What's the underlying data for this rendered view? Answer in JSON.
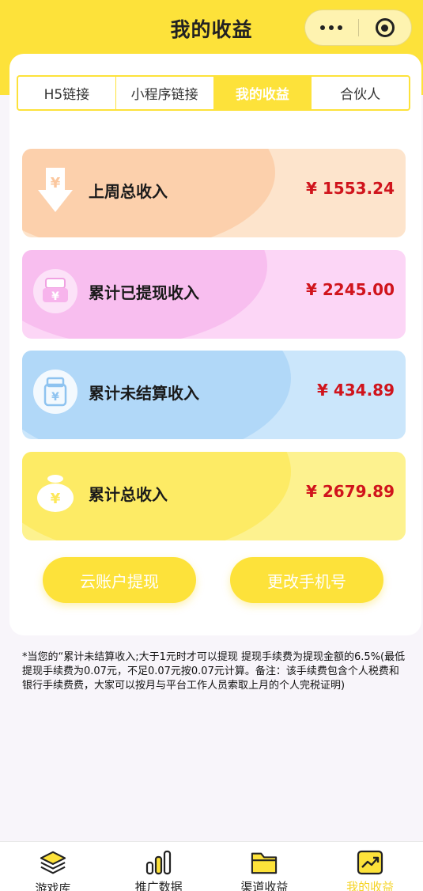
{
  "header": {
    "title": "我的收益"
  },
  "tabs": [
    {
      "label": "H5链接",
      "active": false
    },
    {
      "label": "小程序链接",
      "active": false
    },
    {
      "label": "我的收益",
      "active": true
    },
    {
      "label": "合伙人",
      "active": false
    }
  ],
  "cards": [
    {
      "label": "上周总收入",
      "amount": "¥ 1553.24",
      "icon": "download-yen-icon",
      "icon_glyph": "¥",
      "color": "#fde0c8"
    },
    {
      "label": "累计已提现收入",
      "amount": "¥ 2245.00",
      "icon": "cash-register-icon",
      "icon_glyph": "¥",
      "color": "#fbd0f4"
    },
    {
      "label": "累计未结算收入",
      "amount": "¥ 434.89",
      "icon": "wallet-icon",
      "icon_glyph": "¥",
      "color": "#c5e2fa"
    },
    {
      "label": "累计总收入",
      "amount": "¥ 2679.89",
      "icon": "money-bag-icon",
      "icon_glyph": "¥",
      "color": "#fdf08c"
    }
  ],
  "buttons": {
    "withdraw": "云账户提现",
    "change_phone": "更改手机号"
  },
  "note": "*当您的“累计未结算收入;大于1元时才可以提现 提现手续费为提现金额的6.5%(最低提现手续费为0.07元，不足0.07元按0.07元计算。备注：该手续费包含个人税费和银行手续费费，大家可以按月与平台工作人员索取上月的个人完税证明)",
  "tabbar": [
    {
      "label": "游戏库",
      "icon": "stack-icon",
      "active": false
    },
    {
      "label": "推广数据",
      "icon": "bar-chart-icon",
      "active": false
    },
    {
      "label": "渠道收益",
      "icon": "folder-icon",
      "active": false
    },
    {
      "label": "我的收益",
      "icon": "trend-up-icon",
      "active": true
    }
  ],
  "colors": {
    "brand_yellow": "#fde23a",
    "amount_red": "#d0141c"
  }
}
